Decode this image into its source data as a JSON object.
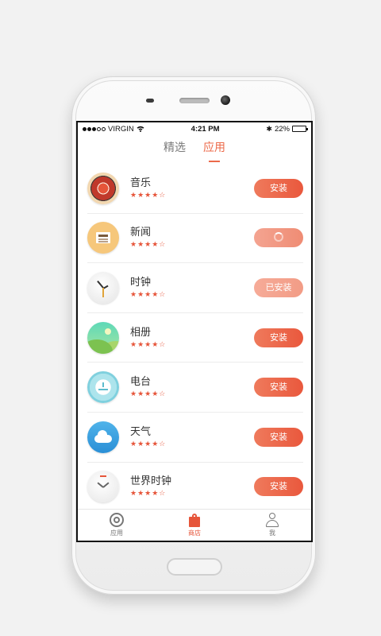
{
  "status": {
    "carrier": "VIRGIN",
    "time": "4:21 PM",
    "battery": "22%",
    "battery_level": 0.22
  },
  "tabs": [
    {
      "label": "精选",
      "active": false
    },
    {
      "label": "应用",
      "active": true
    }
  ],
  "apps": [
    {
      "name": "音乐",
      "stars": "★★★★☆",
      "button": "安装",
      "state": "install"
    },
    {
      "name": "新闻",
      "stars": "★★★★☆",
      "button": "",
      "state": "loading"
    },
    {
      "name": "时钟",
      "stars": "★★★★☆",
      "button": "已安装",
      "state": "installed"
    },
    {
      "name": "相册",
      "stars": "★★★★☆",
      "button": "安装",
      "state": "install"
    },
    {
      "name": "电台",
      "stars": "★★★★☆",
      "button": "安装",
      "state": "install"
    },
    {
      "name": "天气",
      "stars": "★★★★☆",
      "button": "安装",
      "state": "install"
    },
    {
      "name": "世界时钟",
      "stars": "★★★★☆",
      "button": "安装",
      "state": "install"
    }
  ],
  "bottom_nav": [
    {
      "label": "应用",
      "icon": "app-circle-icon",
      "active": false
    },
    {
      "label": "商店",
      "icon": "store-bag-icon",
      "active": true
    },
    {
      "label": "我",
      "icon": "person-icon",
      "active": false
    }
  ],
  "colors": {
    "accent": "#ec6a4a",
    "button_gradient_start": "#ef7a5c",
    "button_gradient_end": "#e9583d"
  }
}
